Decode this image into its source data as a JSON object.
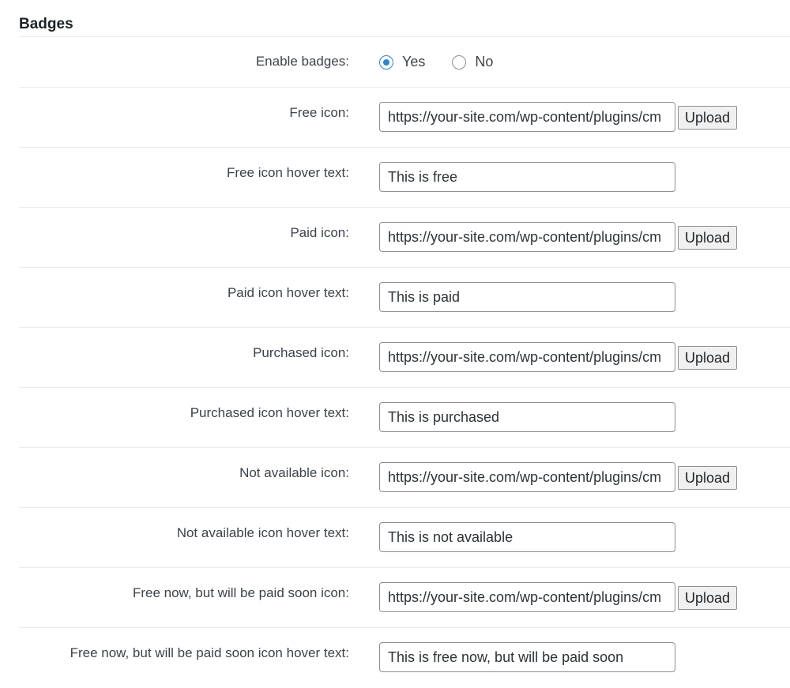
{
  "section": {
    "title": "Badges"
  },
  "enable_badges": {
    "label": "Enable badges:",
    "options": [
      {
        "label": "Yes",
        "checked": true
      },
      {
        "label": "No",
        "checked": false
      }
    ]
  },
  "upload_label": "Upload",
  "fields": [
    {
      "label": "Free icon:",
      "value": "https://your-site.com/wp-content/plugins/cm",
      "has_upload": true
    },
    {
      "label": "Free icon hover text:",
      "value": "This is free",
      "has_upload": false
    },
    {
      "label": "Paid icon:",
      "value": "https://your-site.com/wp-content/plugins/cm",
      "has_upload": true
    },
    {
      "label": "Paid icon hover text:",
      "value": "This is paid",
      "has_upload": false
    },
    {
      "label": "Purchased icon:",
      "value": "https://your-site.com/wp-content/plugins/cm",
      "has_upload": true
    },
    {
      "label": "Purchased icon hover text:",
      "value": "This is purchased",
      "has_upload": false
    },
    {
      "label": "Not available icon:",
      "value": "https://your-site.com/wp-content/plugins/cm",
      "has_upload": true
    },
    {
      "label": "Not available icon hover text:",
      "value": "This is not available",
      "has_upload": false
    },
    {
      "label": "Free now, but will be paid soon icon:",
      "value": "https://your-site.com/wp-content/plugins/cm",
      "has_upload": true
    },
    {
      "label": "Free now, but will be paid soon icon hover text:",
      "value": "This is free now, but will be paid soon",
      "has_upload": false
    }
  ]
}
